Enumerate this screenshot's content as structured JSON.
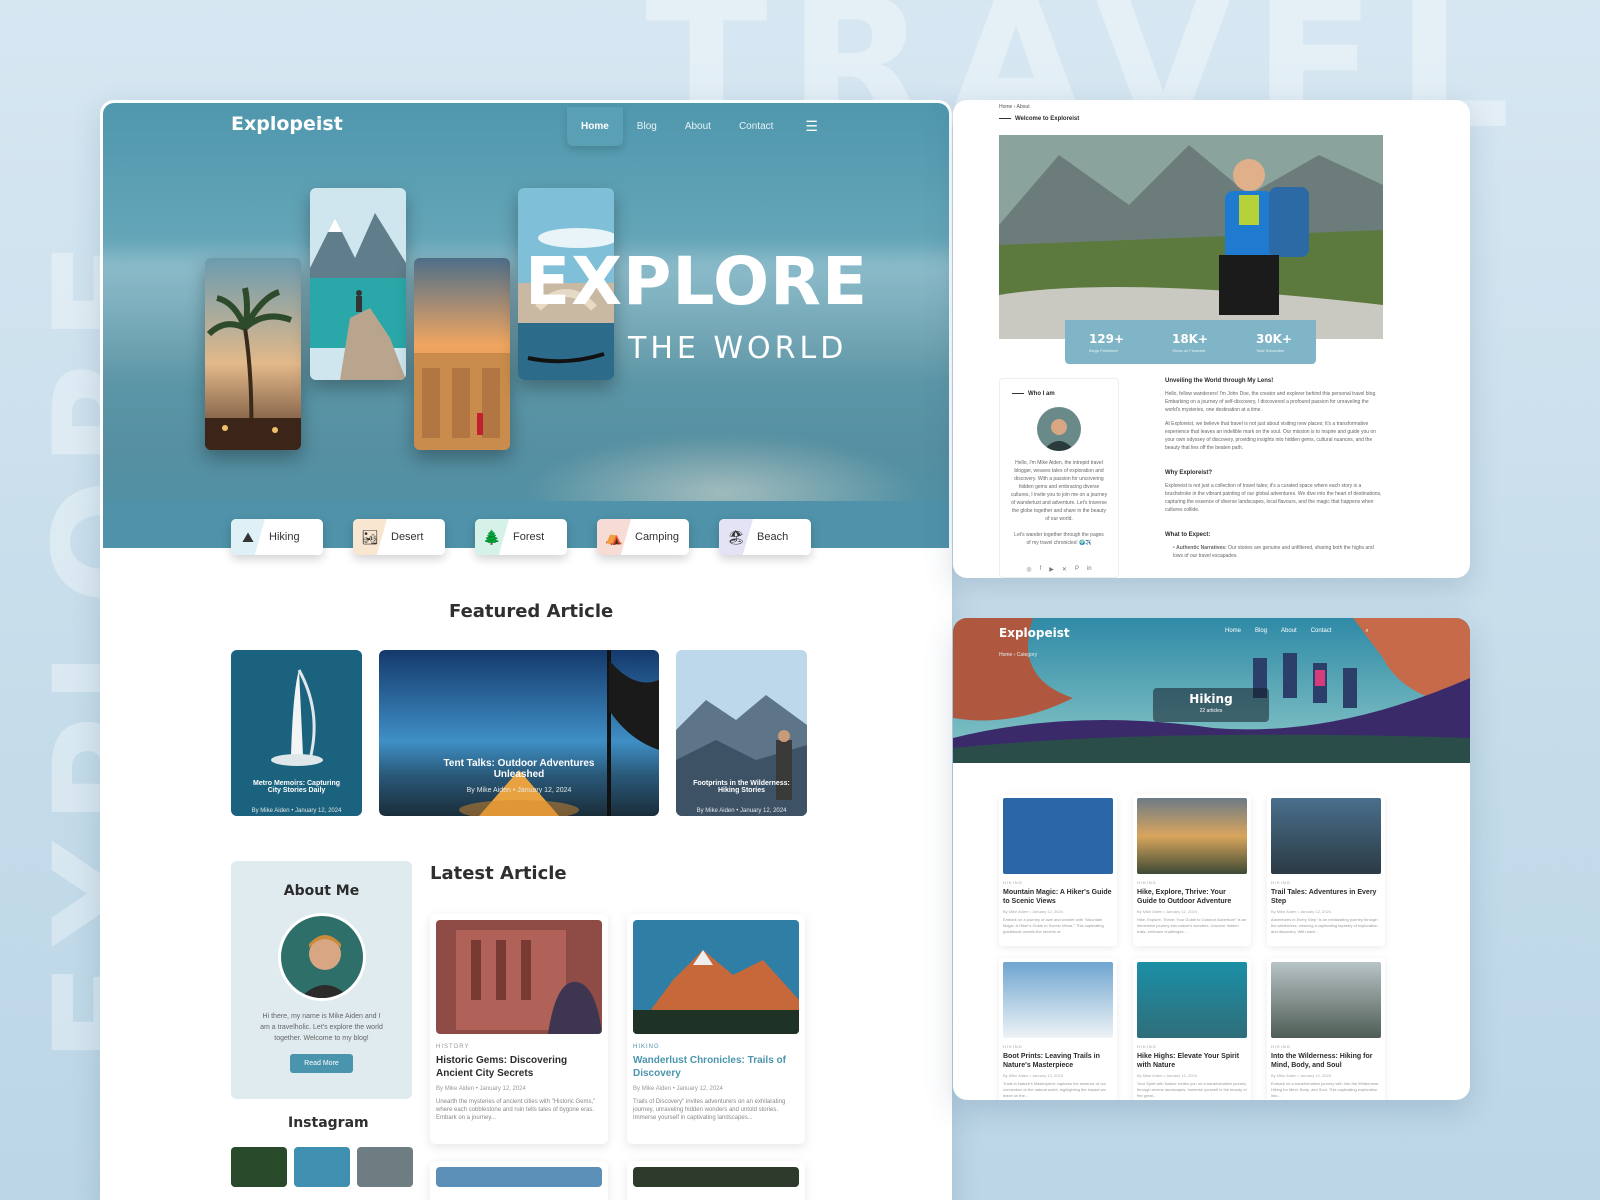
{
  "background": {
    "big_text_top": "TRAVEL",
    "big_text_side": "EXPLORE"
  },
  "colors": {
    "accent": "#4a95ad",
    "hero": "#5d9fb3",
    "background": "#c5dcea"
  },
  "main": {
    "logo": "Explореist",
    "nav": {
      "home": "Home",
      "blog": "Blog",
      "about": "About",
      "contact": "Contact",
      "menu_icon": "hamburger-icon"
    },
    "hero": {
      "title": "EXPLORE",
      "subtitle": "THE WORLD"
    },
    "categories": [
      {
        "label": "Hiking",
        "icon": "hiking-icon",
        "color": "#dff0f6"
      },
      {
        "label": "Desert",
        "icon": "desert-icon",
        "color": "#f8e6d0"
      },
      {
        "label": "Forest",
        "icon": "forest-icon",
        "color": "#d6f1e8"
      },
      {
        "label": "Camping",
        "icon": "camping-icon",
        "color": "#f7dcd5"
      },
      {
        "label": "Beach",
        "icon": "beach-icon",
        "color": "#e3e3f5"
      }
    ],
    "featured_title": "Featured Article",
    "featured": [
      {
        "title": "Metro Memoirs: Capturing City Stories Daily",
        "author": "Mike Aiden",
        "date": "January 12, 2024",
        "by": "By"
      },
      {
        "title": "Tent Talks: Outdoor Adventures Unleashed",
        "author": "Mike Aiden",
        "date": "January 12, 2024",
        "by": "By"
      },
      {
        "title": "Footprints in the Wilderness: Hiking Stories",
        "author": "Mike Aiden",
        "date": "January 12, 2024",
        "by": "By"
      }
    ],
    "about": {
      "title": "About Me",
      "text": "Hi there, my name is Mike Aiden and I am a travelholic. Let's explore the world together. Welcome to my blog!",
      "button": "Read More"
    },
    "latest_title": "Latest Article",
    "latest": [
      {
        "tag": "HISTORY",
        "title": "Historic Gems: Discovering Ancient City Secrets",
        "by": "By",
        "author": "Mike Aiden",
        "date": "January 12, 2024",
        "excerpt": "Unearth the mysteries of ancient cities with \"Historic Gems,\" where each cobblestone and ruin tells tales of bygone eras. Embark on a journey..."
      },
      {
        "tag": "HIKING",
        "title": "Wanderlust Chronicles: Trails of Discovery",
        "by": "By",
        "author": "Mike Aiden",
        "date": "January 12, 2024",
        "excerpt": "Trails of Discovery\" invites adventurers on an exhilarating journey, unraveling hidden wonders and untold stories. Immerse yourself in captivating landscapes..."
      }
    ],
    "instagram_title": "Instagram"
  },
  "about_page": {
    "breadcrumb": {
      "home": "Home",
      "sep": "›",
      "current": "About"
    },
    "heading": "Welcome to Explоreist",
    "stats": [
      {
        "value": "129+",
        "label": "Blogs Published"
      },
      {
        "value": "18K+",
        "label": "Views on Finsweet"
      },
      {
        "value": "30K+",
        "label": "Total Subscriber"
      }
    ],
    "who_title": "Who I am",
    "who_text": "Hello, I'm Mike Aiden, the intrepid travel blogger, weaves tales of exploration and discovery. With a passion for uncovering hidden gems and embracing diverse cultures, I invite you to join me on a journey of wanderlust and adventure. Let's traverse the globe together and share in the beauty of our world.",
    "who_text2": "Let's wander together through the pages of my travel chronicles! 🌍✈️",
    "social": [
      "instagram-icon",
      "facebook-icon",
      "youtube-icon",
      "x-icon",
      "pinterest-icon",
      "linkedin-icon"
    ],
    "sections": [
      {
        "title": "Unveiling the World through My Lens!",
        "text": "Hello, fellow wanderers! I'm John Doe, the creator and explorer behind this personal travel blog. Embarking on a journey of self-discovery, I discovered a profound passion for unraveling the world's mysteries, one destination at a time.",
        "text2": "At Explоreist, we believe that travel is not just about visiting new places; it's a transformative experience that leaves an indelible mark on the soul. Our mission is to inspire and guide you on your own odyssey of discovery, providing insights into hidden gems, cultural nuances, and the beauty that lies off the beaten path."
      },
      {
        "title": "Why Explоreist?",
        "text": "Explоreist is not just a collection of travel tales; it's a curated space where each story is a brushstroke in the vibrant painting of our global adventures. We dive into the heart of destinations, capturing the essence of diverse landscapes, local flavours, and the magic that happens when cultures collide."
      },
      {
        "title": "What to Expect:",
        "bullet_label": "Authentic Narratives:",
        "bullet_text": "Our stories are genuine and unfiltered, sharing both the highs and lows of our travel escapades."
      }
    ]
  },
  "hiking_page": {
    "logo": "Explореist",
    "nav": {
      "home": "Home",
      "blog": "Blog",
      "about": "About",
      "contact": "Contact"
    },
    "breadcrumb": {
      "home": "Home",
      "sep": "›",
      "current": "Category"
    },
    "title": "Hiking",
    "count": "22 articles",
    "cards": [
      {
        "tag": "HIKING",
        "title": "Mountain Magic: A Hiker's Guide to Scenic Views",
        "by": "By",
        "author": "Mike Aiden",
        "date": "January 12, 2024",
        "excerpt": "Embark on a journey of awe and wonder with \"Mountain Magic: A Hiker's Guide to Scenic Views.\" This captivating guidebook unveils the secrets of..."
      },
      {
        "tag": "HIKING",
        "title": "Hike, Explore, Thrive: Your Guide to Outdoor Adventure",
        "by": "By",
        "author": "Mike Aiden",
        "date": "January 12, 2024",
        "excerpt": "Hike, Explore, Thrive: Your Guide to Outdoor Adventure\" is an immersive journey into nature's wonders. Uncover hidden trails, embrace challenges..."
      },
      {
        "tag": "HIKING",
        "title": "Trail Tales: Adventures in Every Step",
        "by": "By",
        "author": "Mike Aiden",
        "date": "January 12, 2024",
        "excerpt": "Adventures in Every Step\" is an exhilarating journey through the wilderness, weaving a captivating tapestry of exploration and discovery. With each..."
      },
      {
        "tag": "HIKING",
        "title": "Boot Prints: Leaving Trails in Nature's Masterpiece",
        "by": "By",
        "author": "Mike Aiden",
        "date": "January 12, 2024",
        "excerpt": "Trails in Nature's Masterpiece captures the essence of our connection to the natural world, highlighting the impact we leave on the..."
      },
      {
        "tag": "HIKING",
        "title": "Hike Highs: Elevate Your Spirit with Nature",
        "by": "By",
        "author": "Mike Aiden",
        "date": "January 12, 2024",
        "excerpt": "Your Spirit with Nature invites you on a transformative journey through serene landscapes. Immerse yourself in the beauty of the great..."
      },
      {
        "tag": "HIKING",
        "title": "Into the Wilderness: Hiking for Mind, Body, and Soul",
        "by": "By",
        "author": "Mike Aiden",
        "date": "January 12, 2024",
        "excerpt": "Embark on a transformative journey with Into the Wilderness: Hiking for Mind, Body, and Soul. This captivating exploration into..."
      }
    ]
  }
}
